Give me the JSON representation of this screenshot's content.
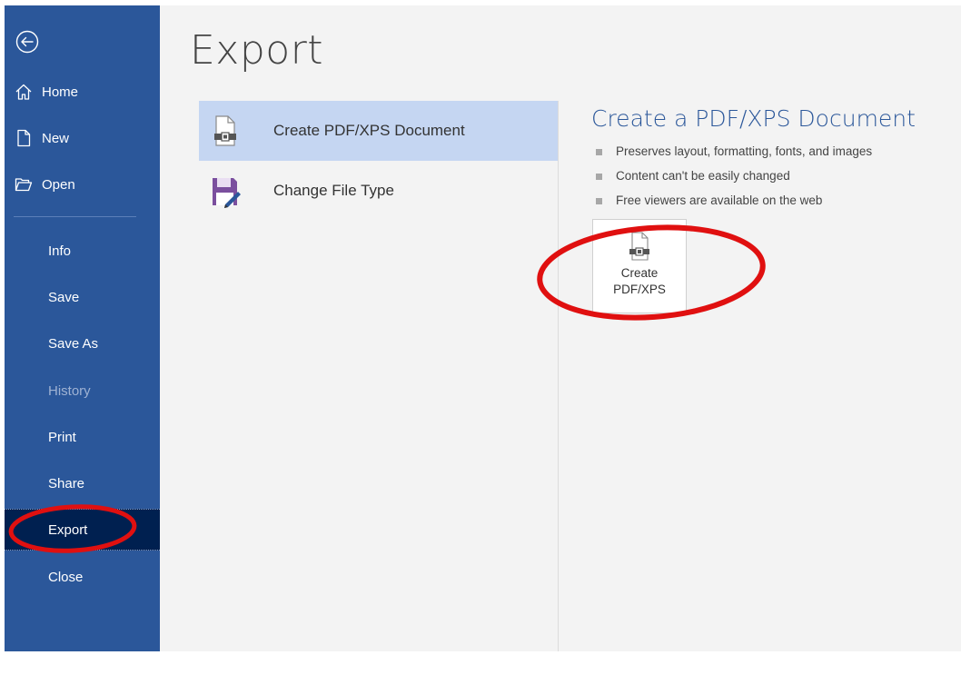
{
  "sidebar": {
    "back_icon": "back-arrow-icon",
    "items": [
      {
        "label": "Home",
        "icon": "home-icon"
      },
      {
        "label": "New",
        "icon": "new-document-icon"
      },
      {
        "label": "Open",
        "icon": "open-folder-icon"
      },
      {
        "label": "Info"
      },
      {
        "label": "Save"
      },
      {
        "label": "Save As"
      },
      {
        "label": "History",
        "disabled": true
      },
      {
        "label": "Print"
      },
      {
        "label": "Share"
      },
      {
        "label": "Export",
        "active": true
      },
      {
        "label": "Close"
      }
    ]
  },
  "main": {
    "title": "Export",
    "options": [
      {
        "label": "Create PDF/XPS Document",
        "icon": "pdf-document-icon",
        "selected": true
      },
      {
        "label": "Change File Type",
        "icon": "change-file-type-icon"
      }
    ],
    "detail": {
      "heading": "Create a PDF/XPS Document",
      "bullets": [
        "Preserves layout, formatting, fonts, and images",
        "Content can't be easily changed",
        "Free viewers are available on the web"
      ],
      "button": {
        "line1": "Create",
        "line2": "PDF/XPS",
        "icon": "pdf-document-icon"
      }
    }
  },
  "colors": {
    "sidebar_bg": "#2b579a",
    "sidebar_active_bg": "#002050",
    "main_bg": "#f3f3f3",
    "selected_option_bg": "#c5d6f2",
    "heading": "#2b579a",
    "annotation_red": "#e01010"
  }
}
